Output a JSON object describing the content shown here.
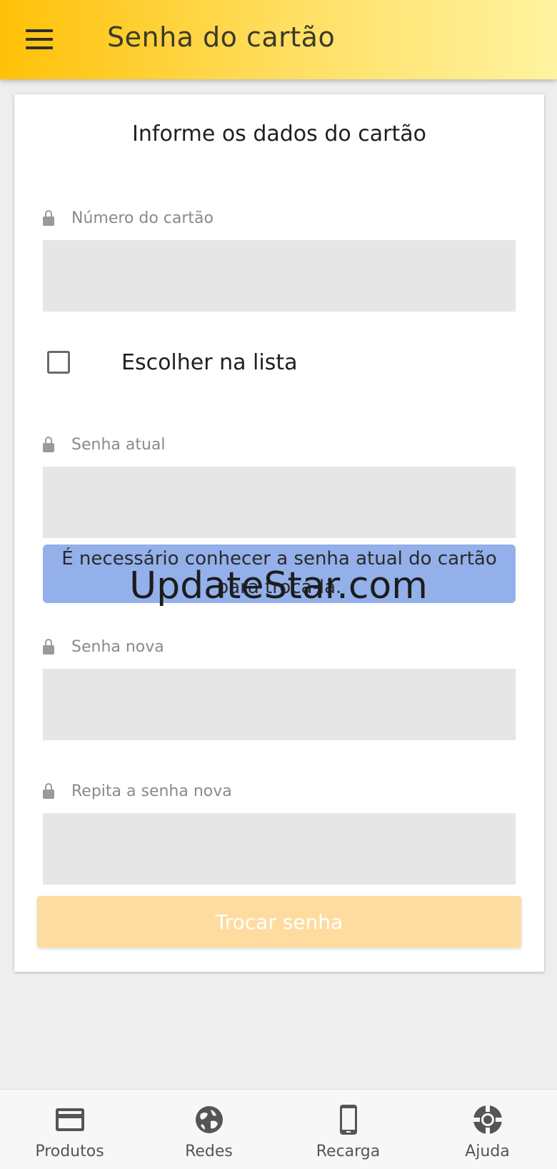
{
  "app_bar": {
    "title": "Senha do cartão"
  },
  "form": {
    "title": "Informe os dados do cartão",
    "card_number_label": "Número do cartão",
    "choose_from_list_label": "Escolher na lista",
    "current_password_label": "Senha atual",
    "info_message": "É necessário conhecer a senha atual do cartão para trocá-la.",
    "new_password_label": "Senha nova",
    "repeat_password_label": "Repita a senha nova",
    "submit_label": "Trocar senha"
  },
  "watermark": "UpdateStar.com",
  "bottom_nav": {
    "items": [
      {
        "label": "Produtos",
        "icon": "credit-card-icon"
      },
      {
        "label": "Redes",
        "icon": "globe-icon"
      },
      {
        "label": "Recarga",
        "icon": "phone-icon"
      },
      {
        "label": "Ajuda",
        "icon": "lifebuoy-icon"
      }
    ]
  },
  "colors": {
    "app_bar_start": "#ffc107",
    "app_bar_end": "#fff3a0",
    "info_box": "#93b0ea",
    "button_disabled": "#fedc9f"
  }
}
